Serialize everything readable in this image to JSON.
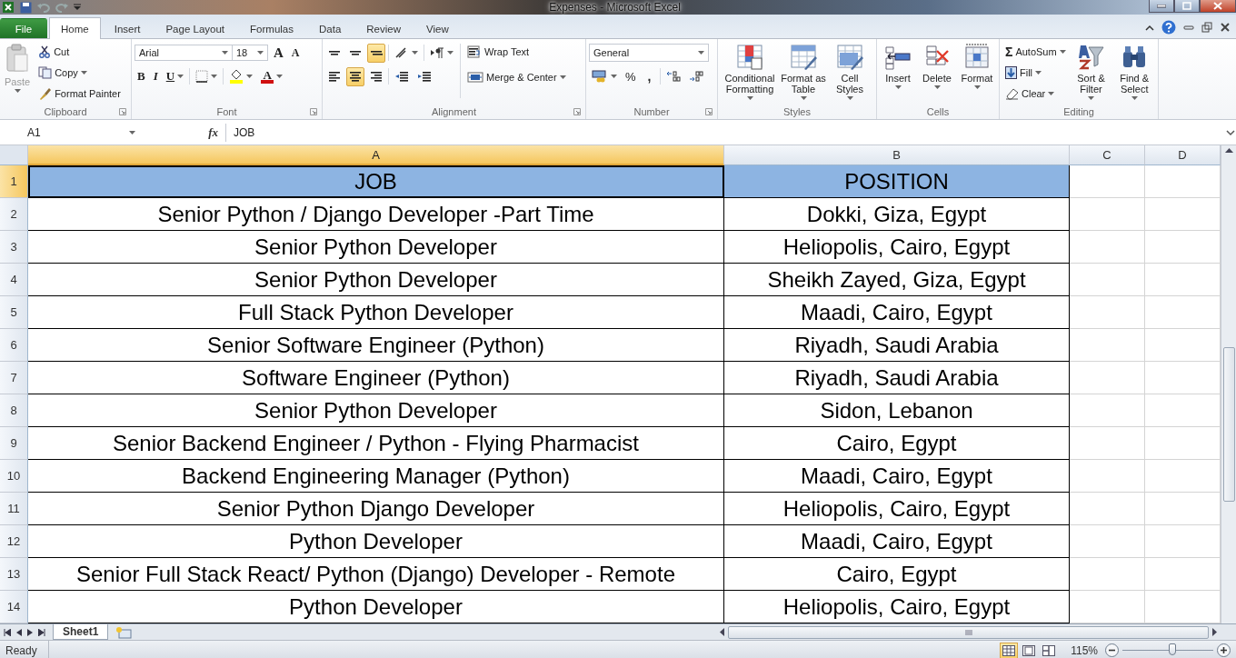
{
  "title_bar": {
    "title": "Expenses  -  Microsoft Excel"
  },
  "tabs": [
    {
      "label": "File",
      "kind": "file",
      "selected": false
    },
    {
      "label": "Home",
      "kind": "tab",
      "selected": true
    },
    {
      "label": "Insert",
      "kind": "tab",
      "selected": false
    },
    {
      "label": "Page Layout",
      "kind": "tab",
      "selected": false
    },
    {
      "label": "Formulas",
      "kind": "tab",
      "selected": false
    },
    {
      "label": "Data",
      "kind": "tab",
      "selected": false
    },
    {
      "label": "Review",
      "kind": "tab",
      "selected": false
    },
    {
      "label": "View",
      "kind": "tab",
      "selected": false
    }
  ],
  "ribbon": {
    "clipboard": {
      "label": "Clipboard",
      "paste": "Paste",
      "cut": "Cut",
      "copy": "Copy",
      "format_painter": "Format Painter"
    },
    "font": {
      "label": "Font",
      "font_name": "Arial",
      "font_size": "18",
      "grow": "A",
      "shrink": "A",
      "bold": "B",
      "italic": "I",
      "underline": "U",
      "font_color": "A"
    },
    "alignment": {
      "label": "Alignment",
      "vertical": [
        {
          "selected": false
        },
        {
          "selected": false
        },
        {
          "selected": true
        }
      ],
      "horizontal": [
        {
          "selected": false
        },
        {
          "selected": true
        },
        {
          "selected": false
        }
      ],
      "wrap_text": "Wrap Text",
      "merge_center": "Merge & Center"
    },
    "number": {
      "label": "Number",
      "format": "General",
      "percent": "%",
      "comma": ","
    },
    "styles": {
      "label": "Styles",
      "buttons": [
        "Conditional Formatting",
        "Format as Table",
        "Cell Styles"
      ]
    },
    "cells": {
      "label": "Cells",
      "buttons": [
        "Insert",
        "Delete",
        "Format"
      ]
    },
    "editing": {
      "label": "Editing",
      "sigma": "Σ",
      "autosum": "AutoSum",
      "fill": "Fill",
      "clear": "Clear",
      "sort": "Sort & Filter",
      "find": "Find & Select"
    }
  },
  "formula_bar": {
    "name_box": "A1",
    "fx": "fx",
    "formula": "JOB"
  },
  "sheet": {
    "columns": [
      {
        "label": "A",
        "selected": true
      },
      {
        "label": "B",
        "selected": false
      },
      {
        "label": "C",
        "selected": false
      },
      {
        "label": "D",
        "selected": false
      }
    ],
    "rows": [
      {
        "number": "1",
        "selected": true,
        "kind": "header",
        "cells": [
          "JOB",
          "POSITION"
        ]
      },
      {
        "number": "2",
        "selected": false,
        "kind": "data",
        "cells": [
          "Senior Python / Django Developer -Part Time",
          "Dokki, Giza, Egypt"
        ]
      },
      {
        "number": "3",
        "selected": false,
        "kind": "data",
        "cells": [
          "Senior Python Developer",
          "Heliopolis, Cairo, Egypt"
        ]
      },
      {
        "number": "4",
        "selected": false,
        "kind": "data",
        "cells": [
          "Senior Python Developer",
          "Sheikh Zayed, Giza, Egypt"
        ]
      },
      {
        "number": "5",
        "selected": false,
        "kind": "data",
        "cells": [
          "Full Stack Python Developer",
          "Maadi, Cairo, Egypt"
        ]
      },
      {
        "number": "6",
        "selected": false,
        "kind": "data",
        "cells": [
          "Senior Software Engineer (Python)",
          "Riyadh, Saudi Arabia"
        ]
      },
      {
        "number": "7",
        "selected": false,
        "kind": "data",
        "cells": [
          "Software Engineer (Python)",
          "Riyadh, Saudi Arabia"
        ]
      },
      {
        "number": "8",
        "selected": false,
        "kind": "data",
        "cells": [
          "Senior Python Developer",
          "Sidon, Lebanon"
        ]
      },
      {
        "number": "9",
        "selected": false,
        "kind": "data",
        "cells": [
          "Senior Backend Engineer / Python - Flying Pharmacist",
          "Cairo, Egypt"
        ]
      },
      {
        "number": "10",
        "selected": false,
        "kind": "data",
        "cells": [
          "Backend Engineering Manager (Python)",
          "Maadi, Cairo, Egypt"
        ]
      },
      {
        "number": "11",
        "selected": false,
        "kind": "data",
        "cells": [
          "Senior Python Django Developer",
          "Heliopolis, Cairo, Egypt"
        ]
      },
      {
        "number": "12",
        "selected": false,
        "kind": "data",
        "cells": [
          "Python Developer",
          "Maadi, Cairo, Egypt"
        ]
      },
      {
        "number": "13",
        "selected": false,
        "kind": "data",
        "cells": [
          "Senior Full Stack React/ Python (Django) Developer - Remote",
          "Cairo, Egypt"
        ]
      },
      {
        "number": "14",
        "selected": false,
        "kind": "data",
        "cells": [
          "Python Developer",
          "Heliopolis, Cairo, Egypt"
        ]
      }
    ]
  },
  "sheet_tabs": [
    {
      "label": "Sheet1",
      "selected": true
    }
  ],
  "status_bar": {
    "status": "Ready",
    "views": [
      {
        "selected": true
      },
      {
        "selected": false
      },
      {
        "selected": false
      }
    ],
    "zoom": "115%",
    "zoom_slider": {
      "level": 0.55
    }
  }
}
